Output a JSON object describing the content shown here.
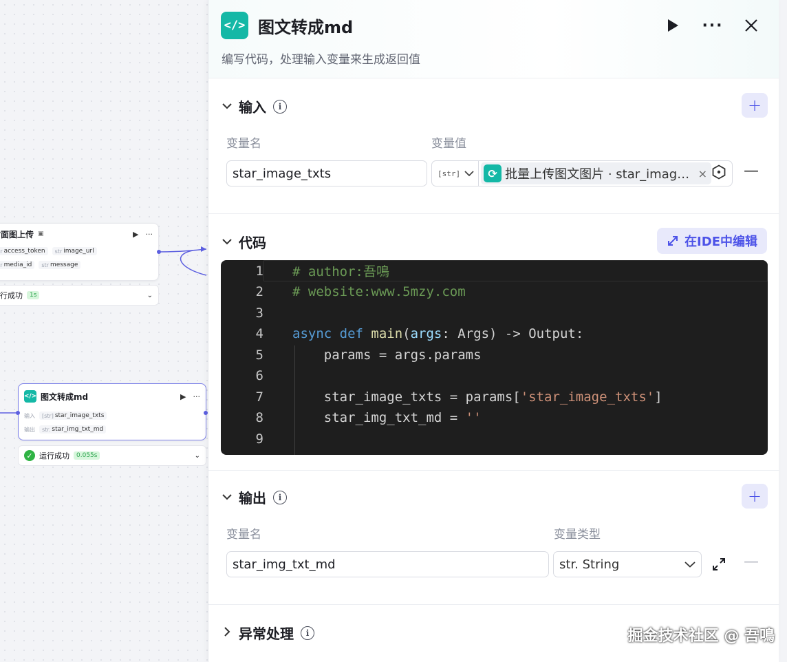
{
  "canvas": {
    "node1": {
      "title": "封面图上传",
      "title_icon": "image-icon",
      "params_row1": [
        {
          "type": "str",
          "name": "access_token"
        },
        {
          "type": "str",
          "name": "image_url"
        }
      ],
      "params_row2": [
        {
          "type": "str",
          "name": "media_id"
        },
        {
          "type": "str",
          "name": "message"
        }
      ],
      "status": "运行成功",
      "duration": "1s"
    },
    "node2": {
      "title": "图文转成md",
      "input_label": "输入",
      "input_type": "[str]",
      "input_name": "star_image_txts",
      "output_label": "输出",
      "output_type": "str.",
      "output_name": "star_img_txt_md",
      "status": "运行成功",
      "duration": "0.055s"
    }
  },
  "panel": {
    "title": "图文转成md",
    "description": "编写代码，处理输入变量来生成返回值",
    "input_section": {
      "title": "输入",
      "col_name": "变量名",
      "col_value": "变量值",
      "var_name": "star_image_txts",
      "type_tag": "[str]",
      "ref_source": "批量上传图文图片 · star_imag…",
      "ref_clear": "×"
    },
    "code_section": {
      "title": "代码",
      "ide_button": "在IDE中编辑",
      "lines": [
        {
          "n": "1",
          "tokens": [
            {
              "c": "com",
              "t": "# author:吾鳴"
            }
          ]
        },
        {
          "n": "2",
          "tokens": [
            {
              "c": "com",
              "t": "# website:www.5mzy.com"
            }
          ]
        },
        {
          "n": "3",
          "tokens": []
        },
        {
          "n": "4",
          "tokens": [
            {
              "c": "kw",
              "t": "async def "
            },
            {
              "c": "fn",
              "t": "main"
            },
            {
              "c": "plain",
              "t": "("
            },
            {
              "c": "var",
              "t": "args"
            },
            {
              "c": "plain",
              "t": ": Args) -> Output:"
            }
          ]
        },
        {
          "n": "5",
          "tokens": [
            {
              "c": "plain",
              "t": "    params = args.params"
            }
          ]
        },
        {
          "n": "6",
          "tokens": []
        },
        {
          "n": "7",
          "tokens": [
            {
              "c": "plain",
              "t": "    star_image_txts = params["
            },
            {
              "c": "str",
              "t": "'star_image_txts'"
            },
            {
              "c": "plain",
              "t": "]"
            }
          ]
        },
        {
          "n": "8",
          "tokens": [
            {
              "c": "plain",
              "t": "    star_img_txt_md = "
            },
            {
              "c": "str",
              "t": "''"
            }
          ]
        },
        {
          "n": "9",
          "tokens": []
        }
      ]
    },
    "output_section": {
      "title": "输出",
      "col_name": "变量名",
      "col_type": "变量类型",
      "var_name": "star_img_txt_md",
      "var_type": "str. String"
    },
    "error_section": {
      "title": "异常处理"
    }
  },
  "watermark": "掘金技术社区 @ 吾鳴",
  "colors": {
    "accent": "#4d53e8",
    "node_icon": "#14b8a6",
    "success": "#2fb344",
    "code_bg": "#1e1e1e"
  }
}
